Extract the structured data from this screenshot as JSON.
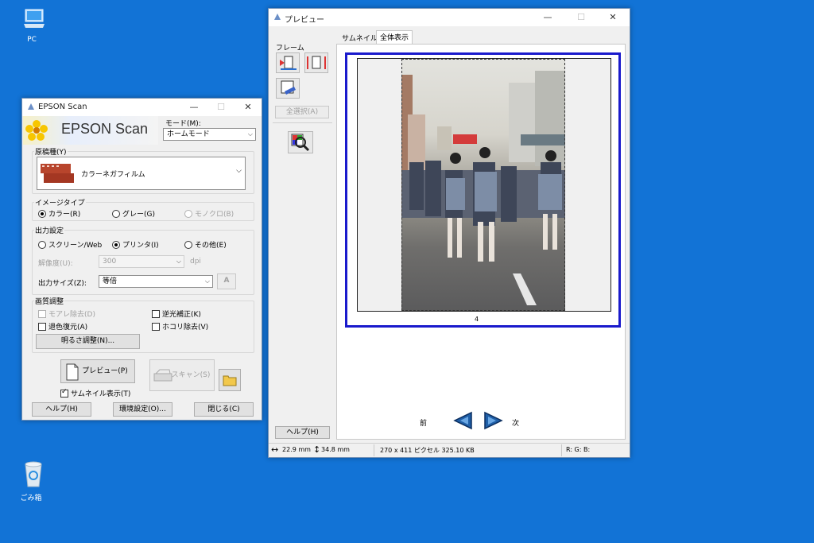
{
  "desktop": {
    "pc_label": "PC",
    "recycle_label": "ごみ箱"
  },
  "epson": {
    "title": "EPSON Scan",
    "brand": "EPSON Scan",
    "mode_label": "モード(M):",
    "mode_value": "ホームモード",
    "source_group": "原稿種(Y)",
    "source_value": "カラーネガフィルム",
    "image_type_group": "イメージタイプ",
    "image_types": [
      "カラー(R)",
      "グレー(G)",
      "モノクロ(B)"
    ],
    "output_group": "出力設定",
    "outputs": [
      "スクリーン/Web",
      "プリンタ(I)",
      "その他(E)"
    ],
    "resolution_label": "解像度(U):",
    "resolution_value": "300",
    "resolution_unit": "dpi",
    "size_label": "出力サイズ(Z):",
    "size_value": "等倍",
    "quality_group": "画質調整",
    "moire": "モアレ除去(D)",
    "backlight": "逆光補正(K)",
    "fade": "退色復元(A)",
    "dust": "ホコリ除去(V)",
    "brightness_button": "明るさ調整(N)...",
    "preview_button": "プレビュー(P)",
    "scan_button": "スキャン(S)",
    "thumbnail_check": "サムネイル表示(T)",
    "help_button": "ヘルプ(H)",
    "config_button": "環境設定(O)...",
    "close_button": "閉じる(C)"
  },
  "preview": {
    "title": "プレビュー",
    "frame_label": "フレーム",
    "select_all_button": "全選択(A)",
    "tabs": [
      "サムネイル",
      "全体表示"
    ],
    "frame_number": "4",
    "prev_label": "前",
    "next_label": "次",
    "help_button": "ヘルプ(H)",
    "status_width": "22.9 mm",
    "status_height": "34.8 mm",
    "status_pixels": "270 x 411 ピクセル 325.10 KB",
    "status_rgb": "R: G: B:"
  },
  "colors": {
    "desktop": "#1273d6",
    "frame_border": "#1a1acc"
  }
}
